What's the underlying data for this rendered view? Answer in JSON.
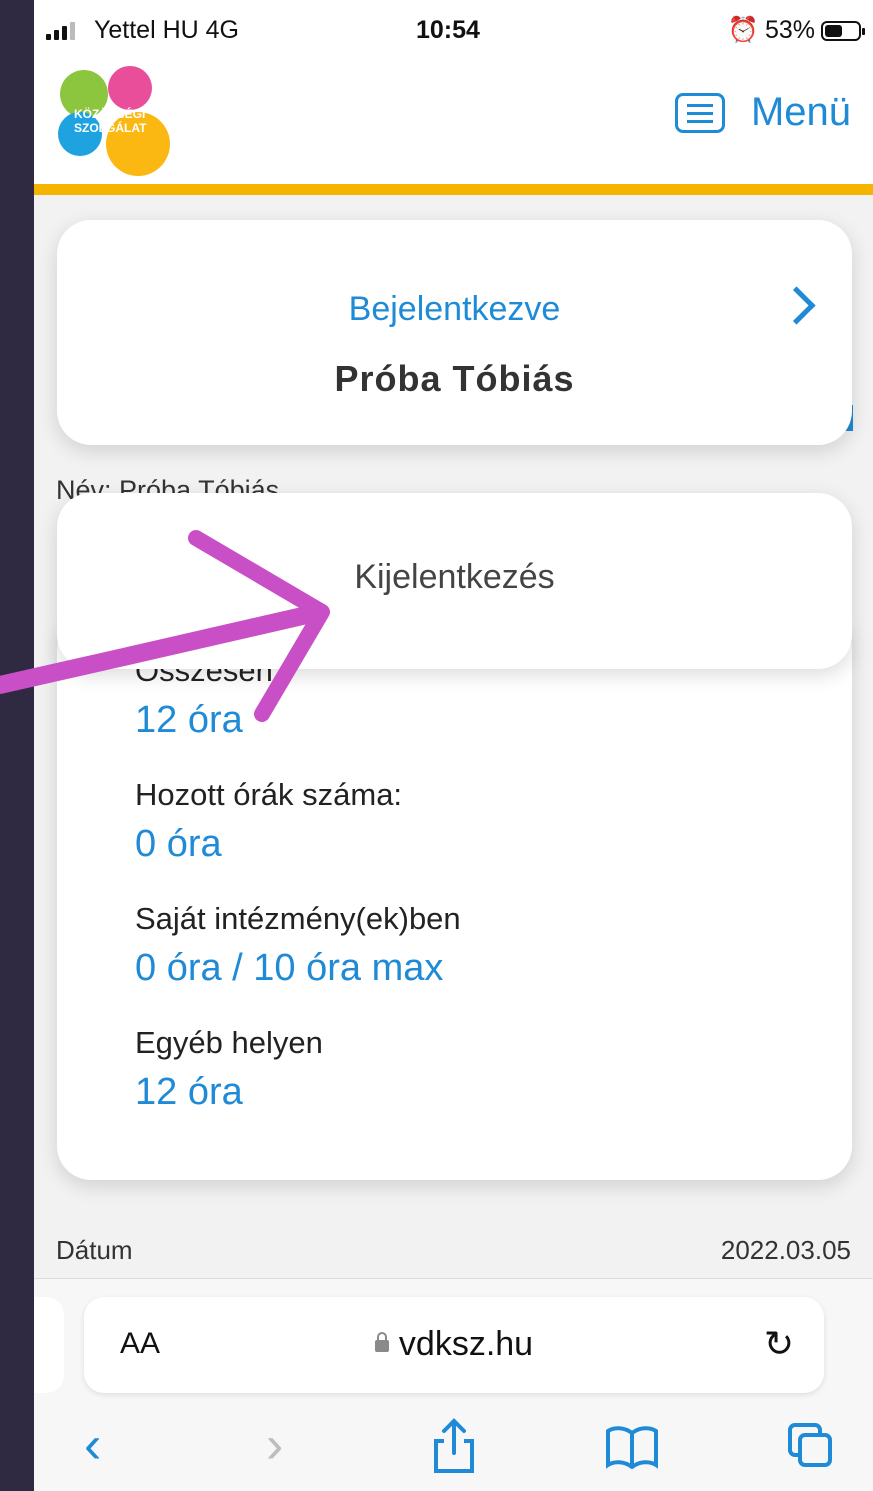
{
  "status_bar": {
    "carrier": "Yettel HU  4G",
    "time": "10:54",
    "battery": "53%",
    "battery_level": 0.53
  },
  "header": {
    "menu_label": "Menü",
    "logo_text_line1": "KÖZÖSSÉGI",
    "logo_text_line2": "SZOLGÁLAT"
  },
  "login_card": {
    "label": "Bejelentkezve",
    "name": "Próba Tóbiás"
  },
  "background_text": "Név: Próba Tóbiás",
  "logout": {
    "label": "Kijelentkezés"
  },
  "stats": {
    "total_label": "Összesen",
    "total_value": "12 óra",
    "brought_label": "Hozott órák száma:",
    "brought_value": "0 óra",
    "own_label": "Saját intézmény(ek)ben",
    "own_value": "0 óra / 10 óra max",
    "other_label": "Egyéb helyen",
    "other_value": "12 óra"
  },
  "table_peek": {
    "date_label": "Dátum",
    "date_value": "2022.03.05"
  },
  "browser": {
    "text_size": "AA",
    "url": "vdksz.hu"
  },
  "colors": {
    "accent": "#1f8ad6",
    "header_line": "#f5b400",
    "annotation_arrow": "#c94fc6"
  }
}
